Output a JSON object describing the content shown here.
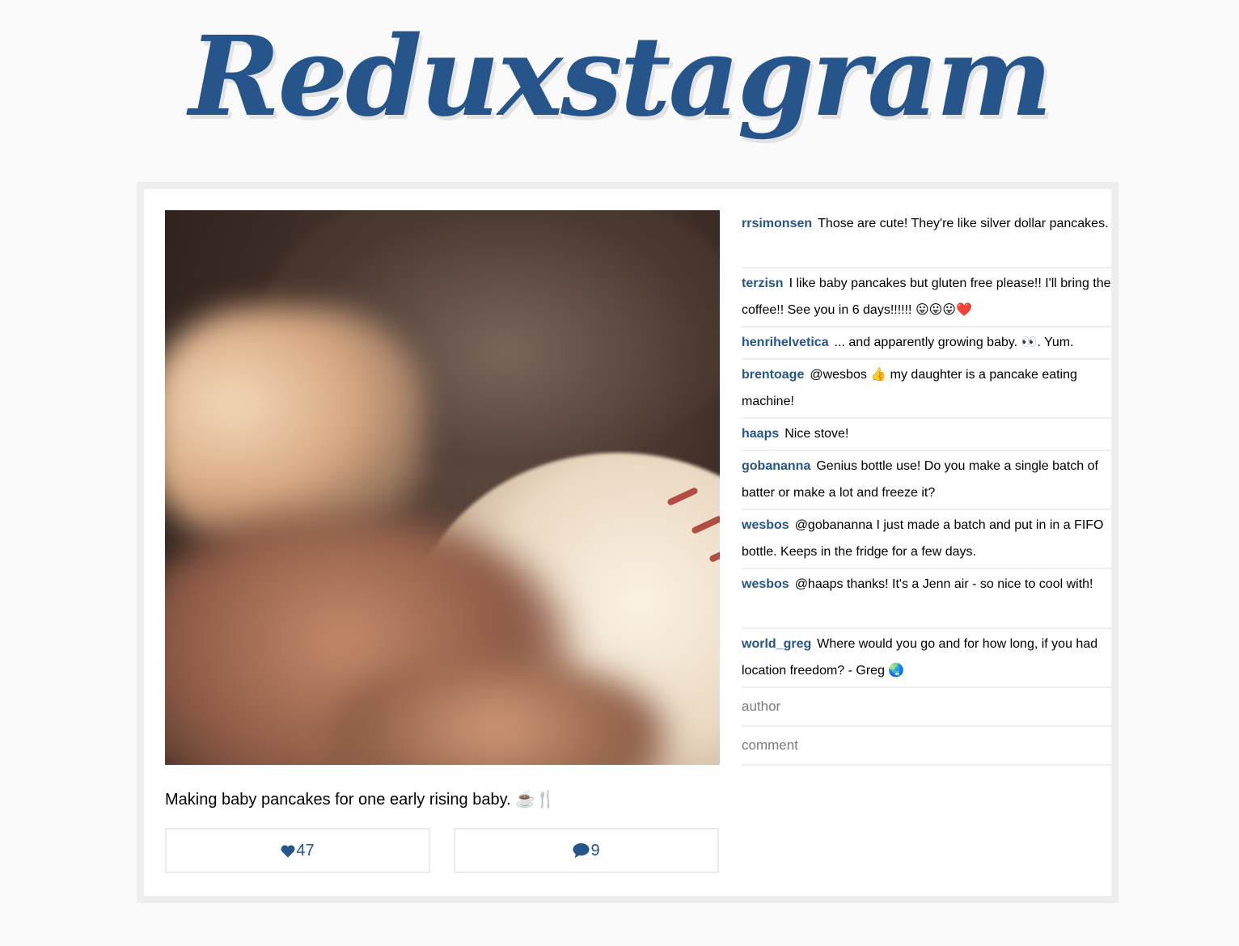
{
  "app": {
    "logo_text": "Reduxstagram"
  },
  "post": {
    "caption": "Making baby pancakes for one early rising baby. ☕️🍴",
    "likes": "47",
    "comment_count": "9"
  },
  "comments": [
    {
      "user": "rrsimonsen",
      "text": "Those are cute! They're like silver dollar pancakes."
    },
    {
      "user": "terzisn",
      "text": "I like baby pancakes but gluten free please!! I'll bring the coffee!! See you in 6 days!!!!!! 😛😛😛❤️"
    },
    {
      "user": "henrihelvetica",
      "text": "... and apparently growing baby. 👀. Yum."
    },
    {
      "user": "brentoage",
      "text": "@wesbos 👍 my daughter is a pancake eating machine!"
    },
    {
      "user": "haaps",
      "text": "Nice stove!"
    },
    {
      "user": "gobananna",
      "text": "Genius bottle use! Do you make a single batch of batter or make a lot and freeze it?"
    },
    {
      "user": "wesbos",
      "text": "@gobananna I just made a batch and put in in a FIFO bottle. Keeps in the fridge for a few days."
    },
    {
      "user": "wesbos",
      "text": "@haaps thanks! It's a Jenn air - so nice to cool with!"
    },
    {
      "user": "world_greg",
      "text": "Where would you go and for how long, if you had location freedom? - Greg 🌏"
    }
  ],
  "form": {
    "author_placeholder": "author",
    "comment_placeholder": "comment"
  },
  "colors": {
    "accent": "#26558b",
    "background": "#fafafa",
    "divider": "#eeeeee"
  }
}
